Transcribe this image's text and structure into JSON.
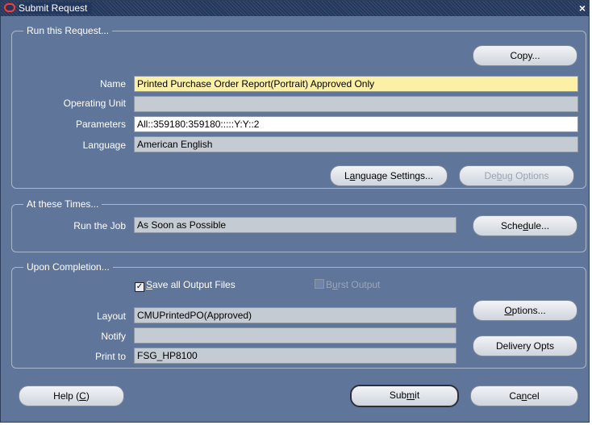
{
  "window": {
    "title": "Submit Request",
    "close": "×"
  },
  "run_request": {
    "group_label": "Run this Request...",
    "copy_button": "Copy...",
    "name_label": "Name",
    "name_value": "Printed Purchase Order Report(Portrait) Approved Only",
    "operating_unit_label": "Operating Unit",
    "operating_unit_value": "",
    "parameters_label": "Parameters",
    "parameters_value": "All::359180:359180:::::Y:Y::2",
    "language_label": "Language",
    "language_value": "American English",
    "language_settings_button": {
      "pre": "L",
      "u": "a",
      "post": "nguage Settings..."
    },
    "debug_options_button": {
      "pre": "De",
      "u": "b",
      "post": "ug Options"
    }
  },
  "times": {
    "group_label": "At these Times...",
    "run_job_label": "Run the Job",
    "run_job_value": "As Soon as Possible",
    "schedule_button": {
      "pre": "Sche",
      "u": "d",
      "post": "ule..."
    }
  },
  "completion": {
    "group_label": "Upon Completion...",
    "save_output": {
      "pre": "",
      "u": "S",
      "post": "ave all Output Files",
      "checked": true
    },
    "burst_output": {
      "pre": "B",
      "u": "u",
      "post": "rst Output",
      "checked": false
    },
    "layout_label": "Layout",
    "layout_value": "CMUPrintedPO(Approved)",
    "options_button": {
      "pre": "",
      "u": "O",
      "post": "ptions..."
    },
    "notify_label": "Notify",
    "notify_value": "",
    "print_to_label": "Print to",
    "print_to_value": "FSG_HP8100",
    "delivery_opts_button": "Delivery Opts"
  },
  "footer": {
    "help_button": {
      "pre": "Help (",
      "u": "C",
      "post": ")"
    },
    "submit_button": {
      "pre": "Sub",
      "u": "m",
      "post": "it"
    },
    "cancel_button": {
      "pre": "Ca",
      "u": "n",
      "post": "cel"
    }
  },
  "colors": {
    "background": "#5f7599",
    "titlebar": "#24385e",
    "required_field": "#fcf0a6",
    "readonly_field": "#c5cbd3"
  }
}
